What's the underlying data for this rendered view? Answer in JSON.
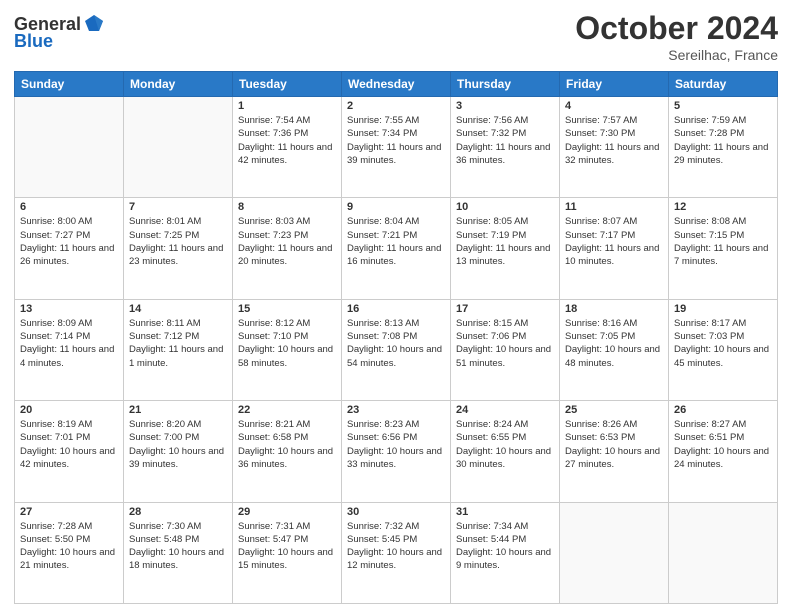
{
  "header": {
    "logo_line1": "General",
    "logo_line2": "Blue",
    "month": "October 2024",
    "location": "Sereilhac, France"
  },
  "weekdays": [
    "Sunday",
    "Monday",
    "Tuesday",
    "Wednesday",
    "Thursday",
    "Friday",
    "Saturday"
  ],
  "weeks": [
    [
      {
        "day": "",
        "info": ""
      },
      {
        "day": "",
        "info": ""
      },
      {
        "day": "1",
        "info": "Sunrise: 7:54 AM\nSunset: 7:36 PM\nDaylight: 11 hours and 42 minutes."
      },
      {
        "day": "2",
        "info": "Sunrise: 7:55 AM\nSunset: 7:34 PM\nDaylight: 11 hours and 39 minutes."
      },
      {
        "day": "3",
        "info": "Sunrise: 7:56 AM\nSunset: 7:32 PM\nDaylight: 11 hours and 36 minutes."
      },
      {
        "day": "4",
        "info": "Sunrise: 7:57 AM\nSunset: 7:30 PM\nDaylight: 11 hours and 32 minutes."
      },
      {
        "day": "5",
        "info": "Sunrise: 7:59 AM\nSunset: 7:28 PM\nDaylight: 11 hours and 29 minutes."
      }
    ],
    [
      {
        "day": "6",
        "info": "Sunrise: 8:00 AM\nSunset: 7:27 PM\nDaylight: 11 hours and 26 minutes."
      },
      {
        "day": "7",
        "info": "Sunrise: 8:01 AM\nSunset: 7:25 PM\nDaylight: 11 hours and 23 minutes."
      },
      {
        "day": "8",
        "info": "Sunrise: 8:03 AM\nSunset: 7:23 PM\nDaylight: 11 hours and 20 minutes."
      },
      {
        "day": "9",
        "info": "Sunrise: 8:04 AM\nSunset: 7:21 PM\nDaylight: 11 hours and 16 minutes."
      },
      {
        "day": "10",
        "info": "Sunrise: 8:05 AM\nSunset: 7:19 PM\nDaylight: 11 hours and 13 minutes."
      },
      {
        "day": "11",
        "info": "Sunrise: 8:07 AM\nSunset: 7:17 PM\nDaylight: 11 hours and 10 minutes."
      },
      {
        "day": "12",
        "info": "Sunrise: 8:08 AM\nSunset: 7:15 PM\nDaylight: 11 hours and 7 minutes."
      }
    ],
    [
      {
        "day": "13",
        "info": "Sunrise: 8:09 AM\nSunset: 7:14 PM\nDaylight: 11 hours and 4 minutes."
      },
      {
        "day": "14",
        "info": "Sunrise: 8:11 AM\nSunset: 7:12 PM\nDaylight: 11 hours and 1 minute."
      },
      {
        "day": "15",
        "info": "Sunrise: 8:12 AM\nSunset: 7:10 PM\nDaylight: 10 hours and 58 minutes."
      },
      {
        "day": "16",
        "info": "Sunrise: 8:13 AM\nSunset: 7:08 PM\nDaylight: 10 hours and 54 minutes."
      },
      {
        "day": "17",
        "info": "Sunrise: 8:15 AM\nSunset: 7:06 PM\nDaylight: 10 hours and 51 minutes."
      },
      {
        "day": "18",
        "info": "Sunrise: 8:16 AM\nSunset: 7:05 PM\nDaylight: 10 hours and 48 minutes."
      },
      {
        "day": "19",
        "info": "Sunrise: 8:17 AM\nSunset: 7:03 PM\nDaylight: 10 hours and 45 minutes."
      }
    ],
    [
      {
        "day": "20",
        "info": "Sunrise: 8:19 AM\nSunset: 7:01 PM\nDaylight: 10 hours and 42 minutes."
      },
      {
        "day": "21",
        "info": "Sunrise: 8:20 AM\nSunset: 7:00 PM\nDaylight: 10 hours and 39 minutes."
      },
      {
        "day": "22",
        "info": "Sunrise: 8:21 AM\nSunset: 6:58 PM\nDaylight: 10 hours and 36 minutes."
      },
      {
        "day": "23",
        "info": "Sunrise: 8:23 AM\nSunset: 6:56 PM\nDaylight: 10 hours and 33 minutes."
      },
      {
        "day": "24",
        "info": "Sunrise: 8:24 AM\nSunset: 6:55 PM\nDaylight: 10 hours and 30 minutes."
      },
      {
        "day": "25",
        "info": "Sunrise: 8:26 AM\nSunset: 6:53 PM\nDaylight: 10 hours and 27 minutes."
      },
      {
        "day": "26",
        "info": "Sunrise: 8:27 AM\nSunset: 6:51 PM\nDaylight: 10 hours and 24 minutes."
      }
    ],
    [
      {
        "day": "27",
        "info": "Sunrise: 7:28 AM\nSunset: 5:50 PM\nDaylight: 10 hours and 21 minutes."
      },
      {
        "day": "28",
        "info": "Sunrise: 7:30 AM\nSunset: 5:48 PM\nDaylight: 10 hours and 18 minutes."
      },
      {
        "day": "29",
        "info": "Sunrise: 7:31 AM\nSunset: 5:47 PM\nDaylight: 10 hours and 15 minutes."
      },
      {
        "day": "30",
        "info": "Sunrise: 7:32 AM\nSunset: 5:45 PM\nDaylight: 10 hours and 12 minutes."
      },
      {
        "day": "31",
        "info": "Sunrise: 7:34 AM\nSunset: 5:44 PM\nDaylight: 10 hours and 9 minutes."
      },
      {
        "day": "",
        "info": ""
      },
      {
        "day": "",
        "info": ""
      }
    ]
  ]
}
